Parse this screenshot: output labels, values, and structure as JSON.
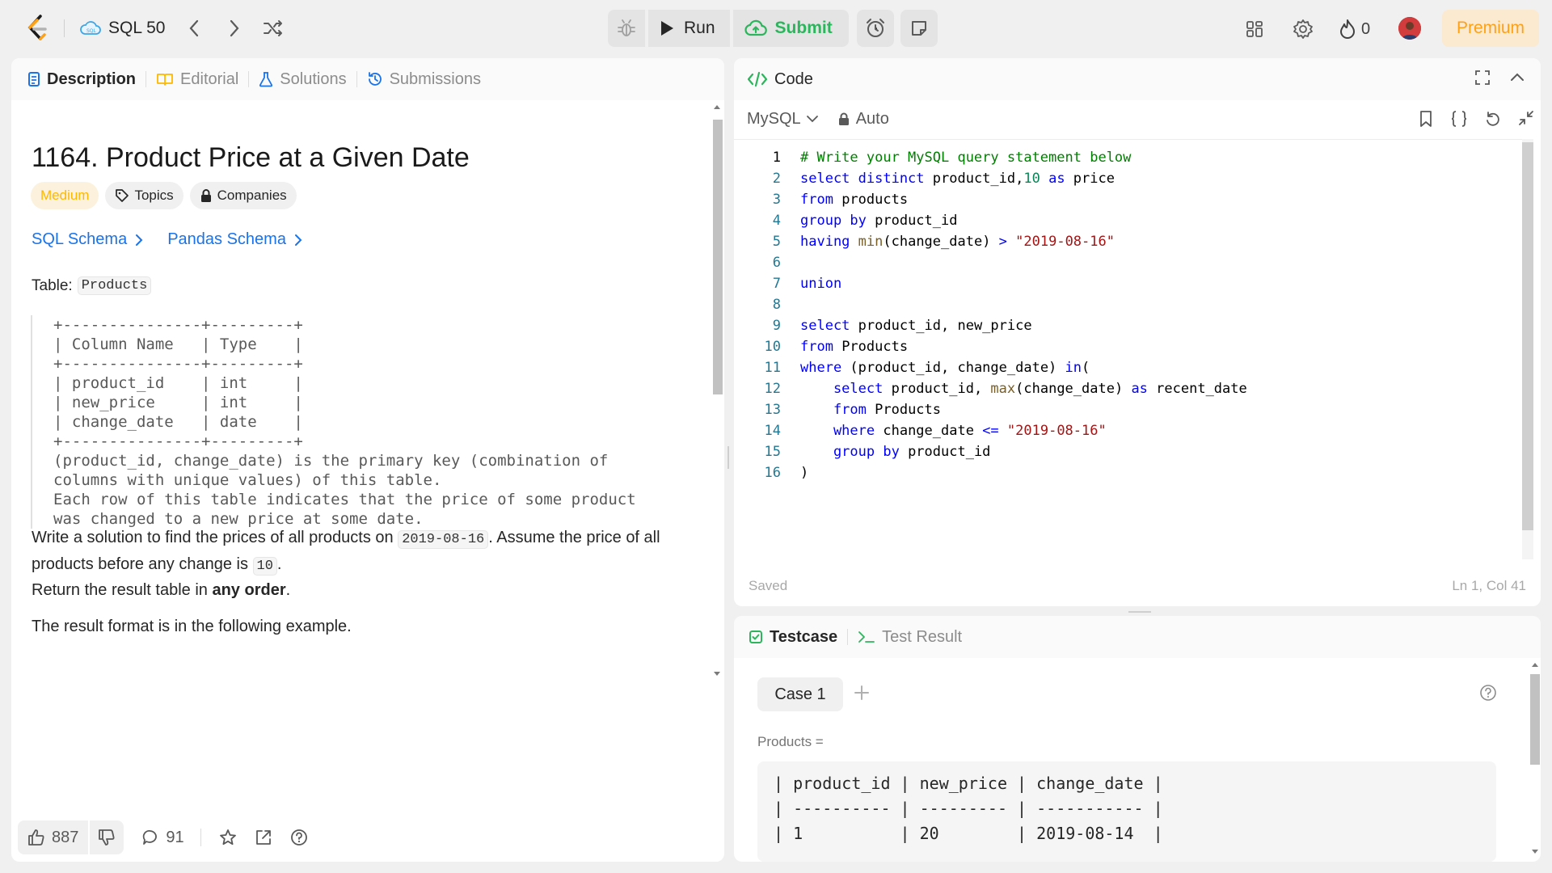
{
  "topbar": {
    "list_title": "SQL 50",
    "run_label": "Run",
    "submit_label": "Submit",
    "streak_count": "0",
    "premium_label": "Premium"
  },
  "left": {
    "tabs": [
      "Description",
      "Editorial",
      "Solutions",
      "Submissions"
    ],
    "title": "1164. Product Price at a Given Date",
    "difficulty": "Medium",
    "topics_label": "Topics",
    "companies_label": "Companies",
    "sql_schema": "SQL Schema",
    "pandas_schema": "Pandas Schema",
    "table_label": "Table:",
    "table_name": "Products",
    "schema_block": "+---------------+---------+\n| Column Name   | Type    |\n+---------------+---------+\n| product_id    | int     |\n| new_price     | int     |\n| change_date   | date    |\n+---------------+---------+\n(product_id, change_date) is the primary key (combination of\ncolumns with unique values) of this table.\nEach row of this table indicates that the price of some product\nwas changed to a new price at some date.",
    "para1_a": "Write a solution to find the prices of all products on ",
    "para1_date": "2019-08-16",
    "para1_b": ". Assume the price of all products before any change is ",
    "para1_val": "10",
    "para1_c": ".",
    "para2_a": "Return the result table in ",
    "para2_bold": "any order",
    "para2_c": ".",
    "para3": "The result format is in the following example.",
    "likes": "887",
    "comments": "91"
  },
  "code": {
    "tab": "Code",
    "language": "MySQL",
    "mode": "Auto",
    "saved": "Saved",
    "cursor": "Ln 1, Col 41",
    "line_numbers": [
      "1",
      "2",
      "3",
      "4",
      "5",
      "6",
      "7",
      "8",
      "9",
      "10",
      "11",
      "12",
      "13",
      "14",
      "15",
      "16"
    ],
    "lines": {
      "l1": "# Write your MySQL query statement below",
      "l2_kw": "select distinct",
      "l2_txt": " product_id,",
      "l2_num": "10",
      "l2_as": " as",
      "l2_end": " price",
      "l3_kw": "from",
      "l3_txt": " products",
      "l4_kw": "group by",
      "l4_txt": " product_id",
      "l5_kw": "having",
      "l5_fn": " min",
      "l5_txt": "(change_date) ",
      "l5_op": ">",
      "l5_str": " \"2019-08-16\"",
      "l7_kw": "union",
      "l9_kw": "select",
      "l9_txt": " product_id, new_price",
      "l10_kw": "from",
      "l10_txt": " Products",
      "l11_kw": "where",
      "l11_txt": " (product_id, change_date) ",
      "l11_in": "in",
      "l11_end": "(",
      "l12_kw": "    select",
      "l12_txt": " product_id, ",
      "l12_fn": "max",
      "l12_txt2": "(change_date) ",
      "l12_as": "as",
      "l12_end": " recent_date",
      "l13_kw": "    from",
      "l13_txt": " Products",
      "l14_kw": "    where",
      "l14_txt": " change_date ",
      "l14_op": "<=",
      "l14_str": " \"2019-08-16\"",
      "l15_kw": "    group by",
      "l15_txt": " product_id",
      "l16": ")"
    }
  },
  "test": {
    "tabs": [
      "Testcase",
      "Test Result"
    ],
    "case_label": "Case 1",
    "products_label": "Products =",
    "table_text": "| product_id | new_price | change_date |\n| ---------- | --------- | ----------- |\n| 1          | 20        | 2019-08-14  |"
  },
  "colors": {
    "accent_green": "#2db55d",
    "premium_orange": "#ffa116",
    "medium_yellow": "#ffb800",
    "link_blue": "#1a73e8"
  }
}
